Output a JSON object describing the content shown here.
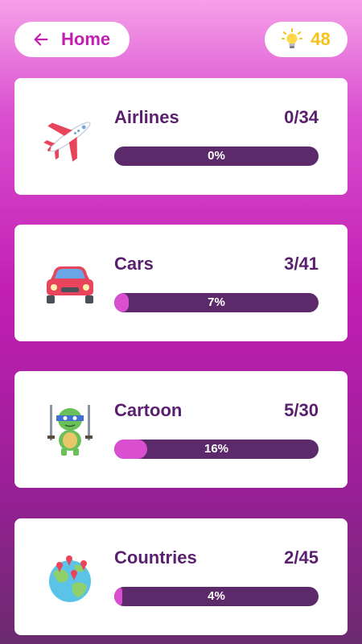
{
  "header": {
    "home_label": "Home",
    "score": "48"
  },
  "categories": [
    {
      "name": "Airlines",
      "count": "0/34",
      "percent_label": "0%",
      "progress": 0.0,
      "icon": "airplane-icon"
    },
    {
      "name": "Cars",
      "count": "3/41",
      "percent_label": "7%",
      "progress": 0.07,
      "icon": "car-icon"
    },
    {
      "name": "Cartoon",
      "count": "5/30",
      "percent_label": "16%",
      "progress": 0.16,
      "icon": "ninja-turtle-icon"
    },
    {
      "name": "Countries",
      "count": "2/45",
      "percent_label": "4%",
      "progress": 0.04,
      "icon": "globe-icon"
    }
  ],
  "colors": {
    "accent": "#c21fb2",
    "text": "#5a1f6e",
    "bar_track": "#5c2a6a",
    "bar_fill": "#d94fd0",
    "score": "#f6c21a"
  }
}
